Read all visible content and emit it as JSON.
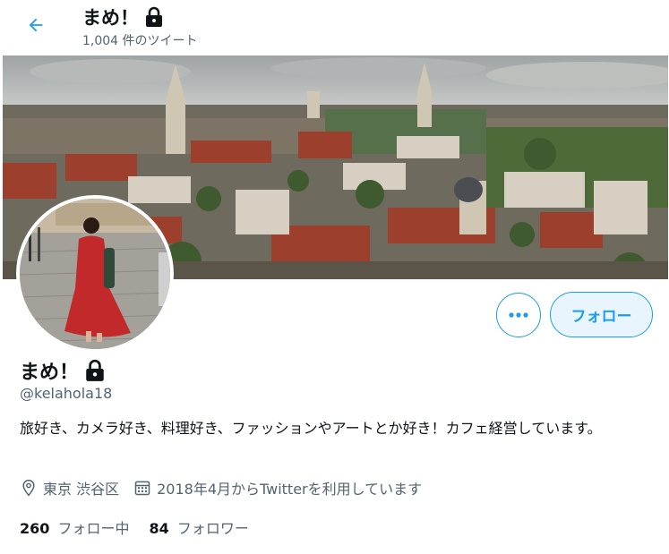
{
  "header": {
    "name": "まめ！",
    "tweet_count": "1,004 件のツイート",
    "back_icon": "arrow-left-icon",
    "lock_icon": "lock-icon"
  },
  "actions": {
    "more_icon": "more-dots-icon",
    "follow_label": "フォロー"
  },
  "profile": {
    "name": "まめ！",
    "handle": "@kelahola18",
    "bio": "旅好き、カメラ好き、料理好き、ファッションやアートとか好き！カフェ経営しています。",
    "location": "東京 渋谷区",
    "joined": "2018年4月からTwitterを利用しています",
    "location_icon": "location-pin-icon",
    "calendar_icon": "calendar-icon"
  },
  "stats": {
    "following_count": "260",
    "following_label": "フォロー中",
    "followers_count": "84",
    "followers_label": "フォロワー"
  },
  "colors": {
    "accent": "#1d9bf0",
    "secondary_text": "#536471",
    "primary_text": "#0f1419"
  }
}
